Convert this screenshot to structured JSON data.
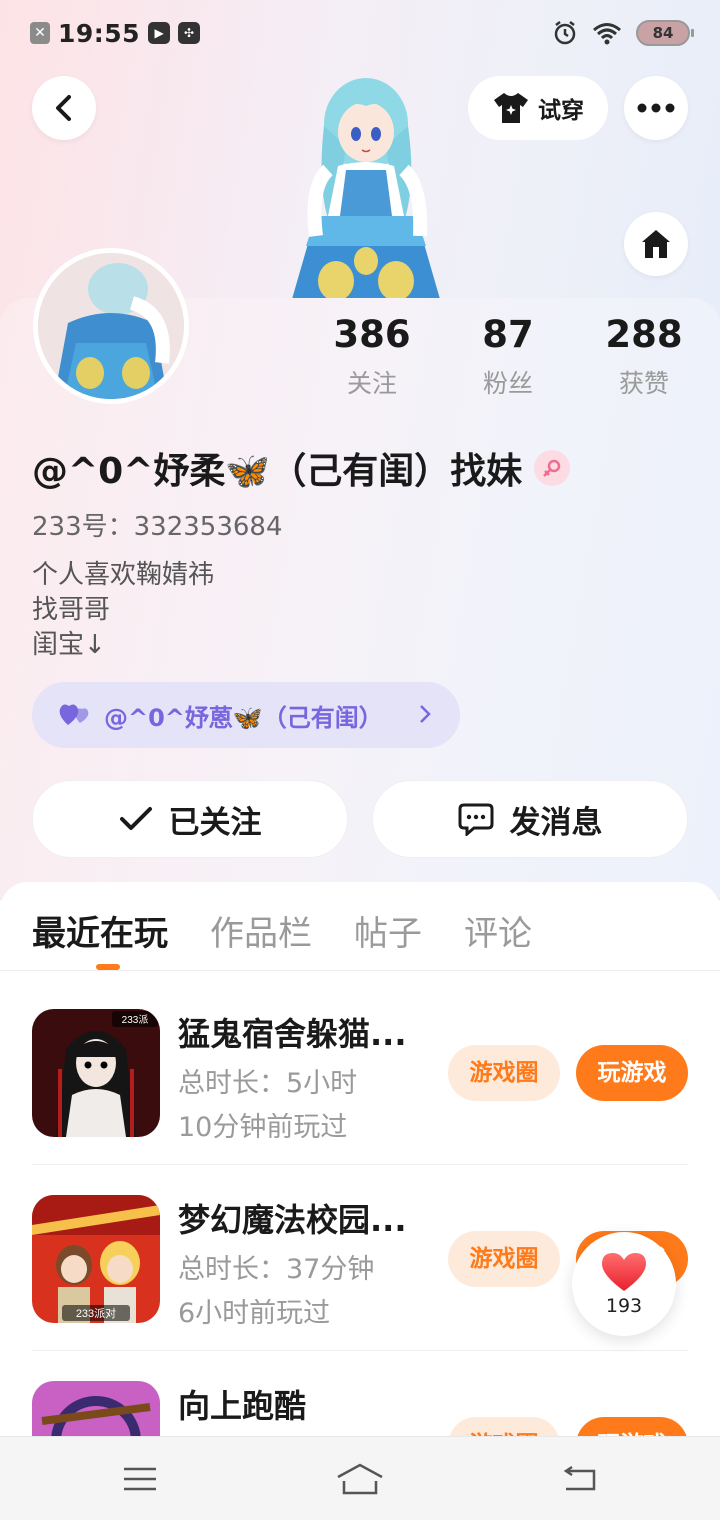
{
  "status_bar": {
    "time": "19:55",
    "battery": "84"
  },
  "header": {
    "try_on_label": "试穿"
  },
  "profile": {
    "stats": [
      {
        "value": "386",
        "label": "关注"
      },
      {
        "value": "87",
        "label": "粉丝"
      },
      {
        "value": "288",
        "label": "获赞"
      }
    ],
    "username": "@^0^妤柔🦋（己有闺）找妹",
    "uid": "233号：332353684",
    "bio_lines": [
      "个人喜欢鞠婧祎",
      "找哥哥",
      "闺宝↓"
    ],
    "couple_label": "@^0^妤蒽🦋（己有闺）"
  },
  "actions": {
    "follow_label": "已关注",
    "message_label": "发消息"
  },
  "tabs": [
    {
      "label": "最近在玩",
      "active": true
    },
    {
      "label": "作品栏",
      "active": false
    },
    {
      "label": "帖子",
      "active": false
    },
    {
      "label": "评论",
      "active": false
    }
  ],
  "games": [
    {
      "title": "猛鬼宿舍躲猫...",
      "duration": "总时长：5小时",
      "last_played": "10分钟前玩过",
      "circle_label": "游戏圈",
      "play_label": "玩游戏",
      "badge": "233派"
    },
    {
      "title": "梦幻魔法校园...",
      "duration": "总时长：37分钟",
      "last_played": "6小时前玩过",
      "circle_label": "游戏圈",
      "play_label": "玩游戏",
      "badge": "233派对"
    },
    {
      "title": "向上跑酷",
      "duration": "",
      "last_played": "",
      "circle_label": "游戏圈",
      "play_label": "玩游戏"
    }
  ],
  "like_float": {
    "count": "193"
  },
  "colors": {
    "accent": "#ff7a1a",
    "couple_text": "#7766dd"
  }
}
